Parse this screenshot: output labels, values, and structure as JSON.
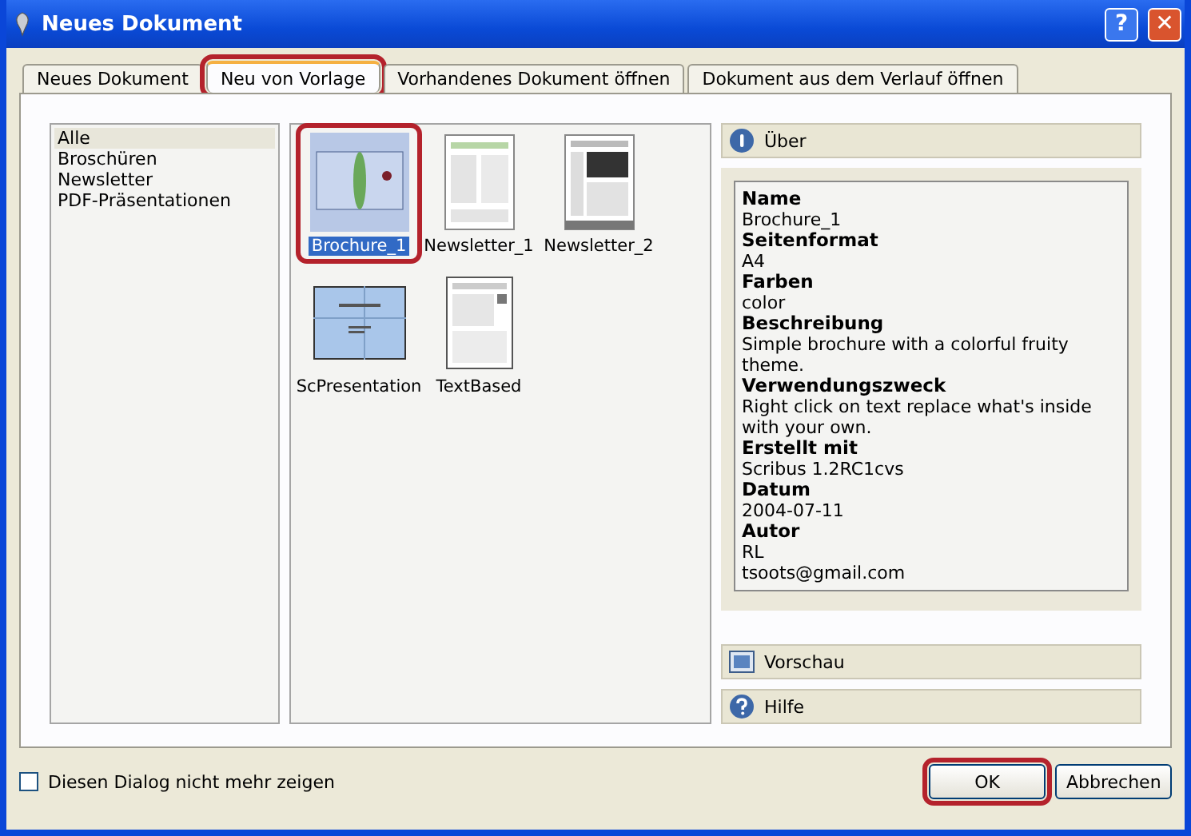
{
  "window": {
    "title": "Neues Dokument",
    "buttons": [
      {
        "kind": "help",
        "label": "?"
      },
      {
        "kind": "close",
        "label": "✕"
      }
    ]
  },
  "tabs": [
    {
      "label": "Neues Dokument",
      "selected": false,
      "highlighted": false
    },
    {
      "label": "Neu von Vorlage",
      "selected": true,
      "highlighted": true
    },
    {
      "label": "Vorhandenes Dokument öffnen",
      "selected": false,
      "highlighted": false
    },
    {
      "label": "Dokument aus dem Verlauf öffnen",
      "selected": false,
      "highlighted": false
    }
  ],
  "categories": [
    {
      "label": "Alle",
      "selected": true
    },
    {
      "label": "Broschüren",
      "selected": false
    },
    {
      "label": "Newsletter",
      "selected": false
    },
    {
      "label": "PDF-Präsentationen",
      "selected": false
    }
  ],
  "templates": [
    {
      "name": "Brochure_1",
      "kind": "brochure",
      "selected": true,
      "highlighted": true
    },
    {
      "name": "Newsletter_1",
      "kind": "newsletter",
      "selected": false,
      "highlighted": false
    },
    {
      "name": "Newsletter_2",
      "kind": "photo",
      "selected": false,
      "highlighted": false
    },
    {
      "name": "ScPresentation",
      "kind": "presentation",
      "selected": false,
      "highlighted": false
    },
    {
      "name": "TextBased",
      "kind": "text",
      "selected": false,
      "highlighted": false
    }
  ],
  "sections": [
    {
      "label": "Über",
      "kind": "info"
    },
    {
      "label": "Vorschau",
      "kind": "preview"
    },
    {
      "label": "Hilfe",
      "kind": "help"
    }
  ],
  "details": [
    {
      "label": "Name",
      "lines": [
        "Brochure_1"
      ]
    },
    {
      "label": "Seitenformat",
      "lines": [
        "A4"
      ]
    },
    {
      "label": "Farben",
      "lines": [
        "color"
      ]
    },
    {
      "label": "Beschreibung",
      "lines": [
        "Simple brochure with a colorful fruity theme."
      ]
    },
    {
      "label": "Verwendungszweck",
      "lines": [
        "Right click on text replace what's inside with your own."
      ]
    },
    {
      "label": "Erstellt mit",
      "lines": [
        "Scribus 1.2RC1cvs"
      ]
    },
    {
      "label": "Datum",
      "lines": [
        "2004-07-11"
      ]
    },
    {
      "label": "Autor",
      "lines": [
        "RL",
        "tsoots@gmail.com"
      ]
    }
  ],
  "dont_show_again": {
    "label": "Diesen Dialog nicht mehr zeigen",
    "checked": false
  },
  "buttons": [
    {
      "label": "OK",
      "highlighted": true
    },
    {
      "label": "Abbrechen",
      "highlighted": false
    }
  ]
}
